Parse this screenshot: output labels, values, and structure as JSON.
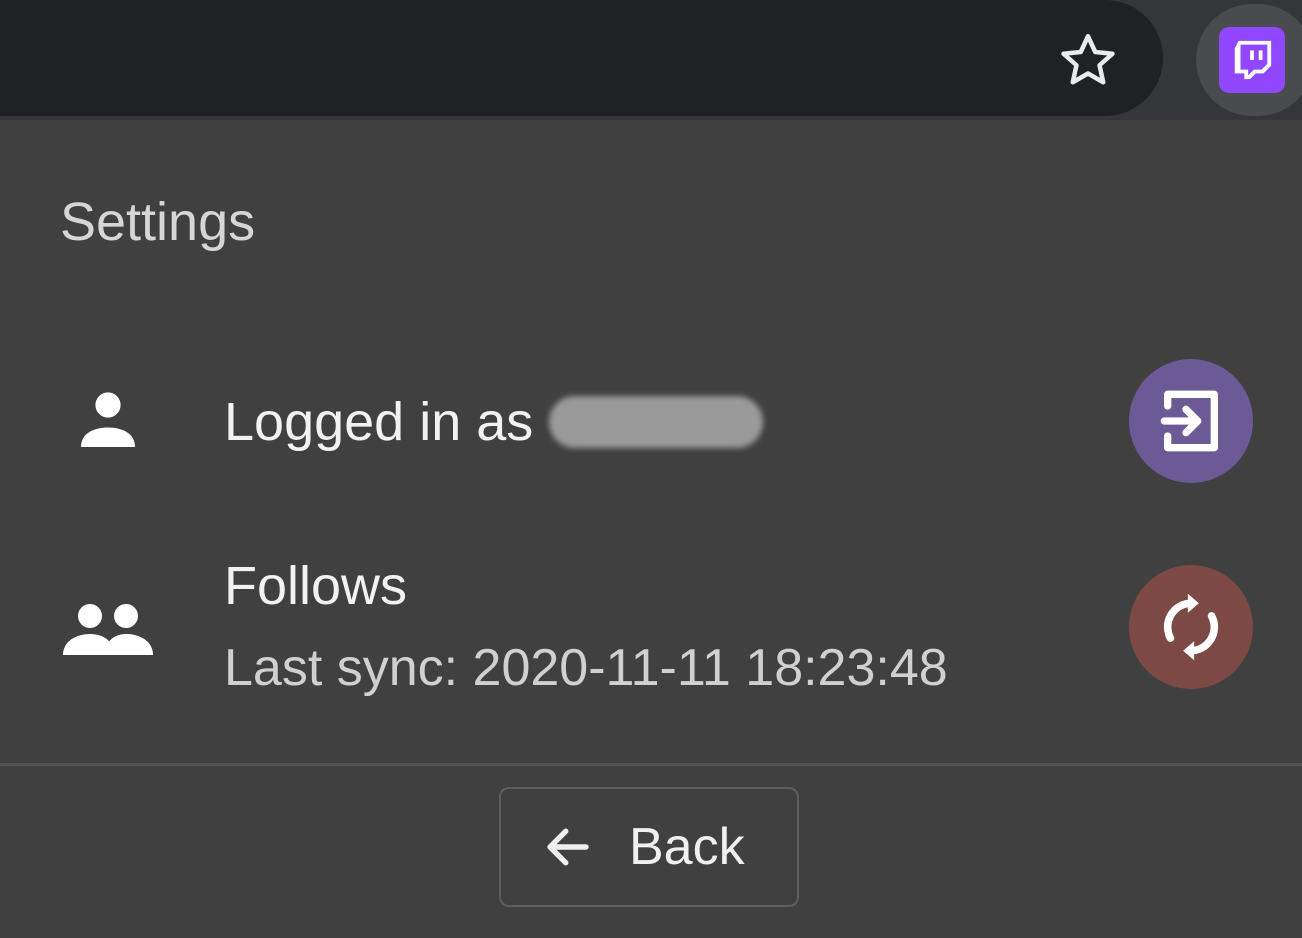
{
  "toolbar": {
    "bookmark_icon": "star-outline-icon",
    "extension_icon": "twitch-glitch-icon",
    "extension_color": "#9146ff"
  },
  "settings": {
    "title": "Settings",
    "account": {
      "icon": "person-icon",
      "label": "Logged in as",
      "action_icon": "login-icon",
      "action_color": "#6c5a96"
    },
    "follows": {
      "icon": "people-icon",
      "label": "Follows",
      "last_sync": "Last sync: 2020-11-11 18:23:48",
      "action_icon": "sync-icon",
      "action_color": "#7d4945"
    }
  },
  "footer": {
    "back_label": "Back",
    "back_icon": "arrow-left-icon"
  }
}
